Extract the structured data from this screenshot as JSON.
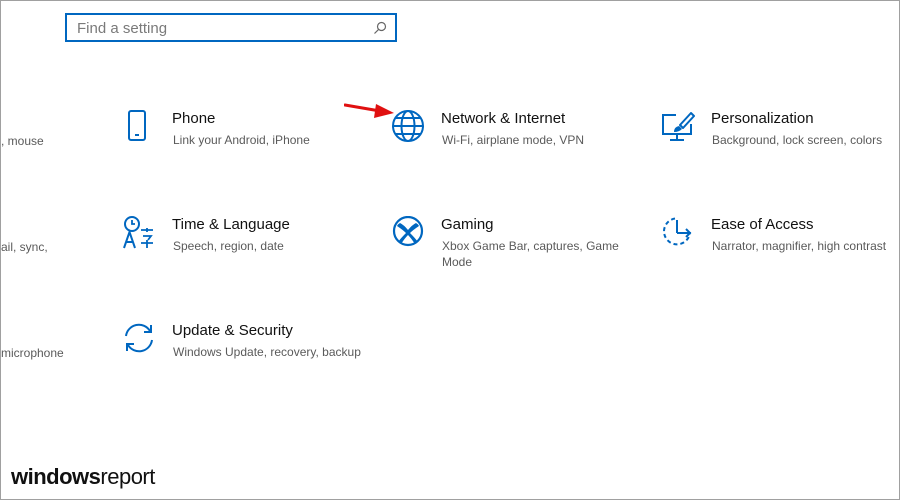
{
  "search": {
    "placeholder": "Find a setting",
    "value": ""
  },
  "partial_left": ", mouse|ail, sync,|microphone",
  "partial": [
    "mouse",
    "ail, sync,",
    "microphone"
  ],
  "tiles": [
    {
      "title": "Phone",
      "desc": "Link your Android, iPhone",
      "icon": "phone-icon"
    },
    {
      "title": "Network & Internet",
      "desc": "Wi-Fi, airplane mode, VPN",
      "icon": "globe-icon"
    },
    {
      "title": "Personalization",
      "desc": "Background, lock screen, colors",
      "icon": "personalization-icon"
    },
    {
      "title": "Time & Language",
      "desc": "Speech, region, date",
      "icon": "time-language-icon"
    },
    {
      "title": "Gaming",
      "desc": "Xbox Game Bar, captures, Game Mode",
      "icon": "xbox-icon"
    },
    {
      "title": "Ease of Access",
      "desc": "Narrator, magnifier, high contrast",
      "icon": "ease-of-access-icon"
    },
    {
      "title": "Update & Security",
      "desc": "Windows Update, recovery, backup",
      "icon": "update-icon"
    }
  ],
  "logo": {
    "part1": "windows",
    "part2": "report"
  },
  "colors": {
    "accent": "#0067c0",
    "annotation_arrow": "#e01010"
  }
}
